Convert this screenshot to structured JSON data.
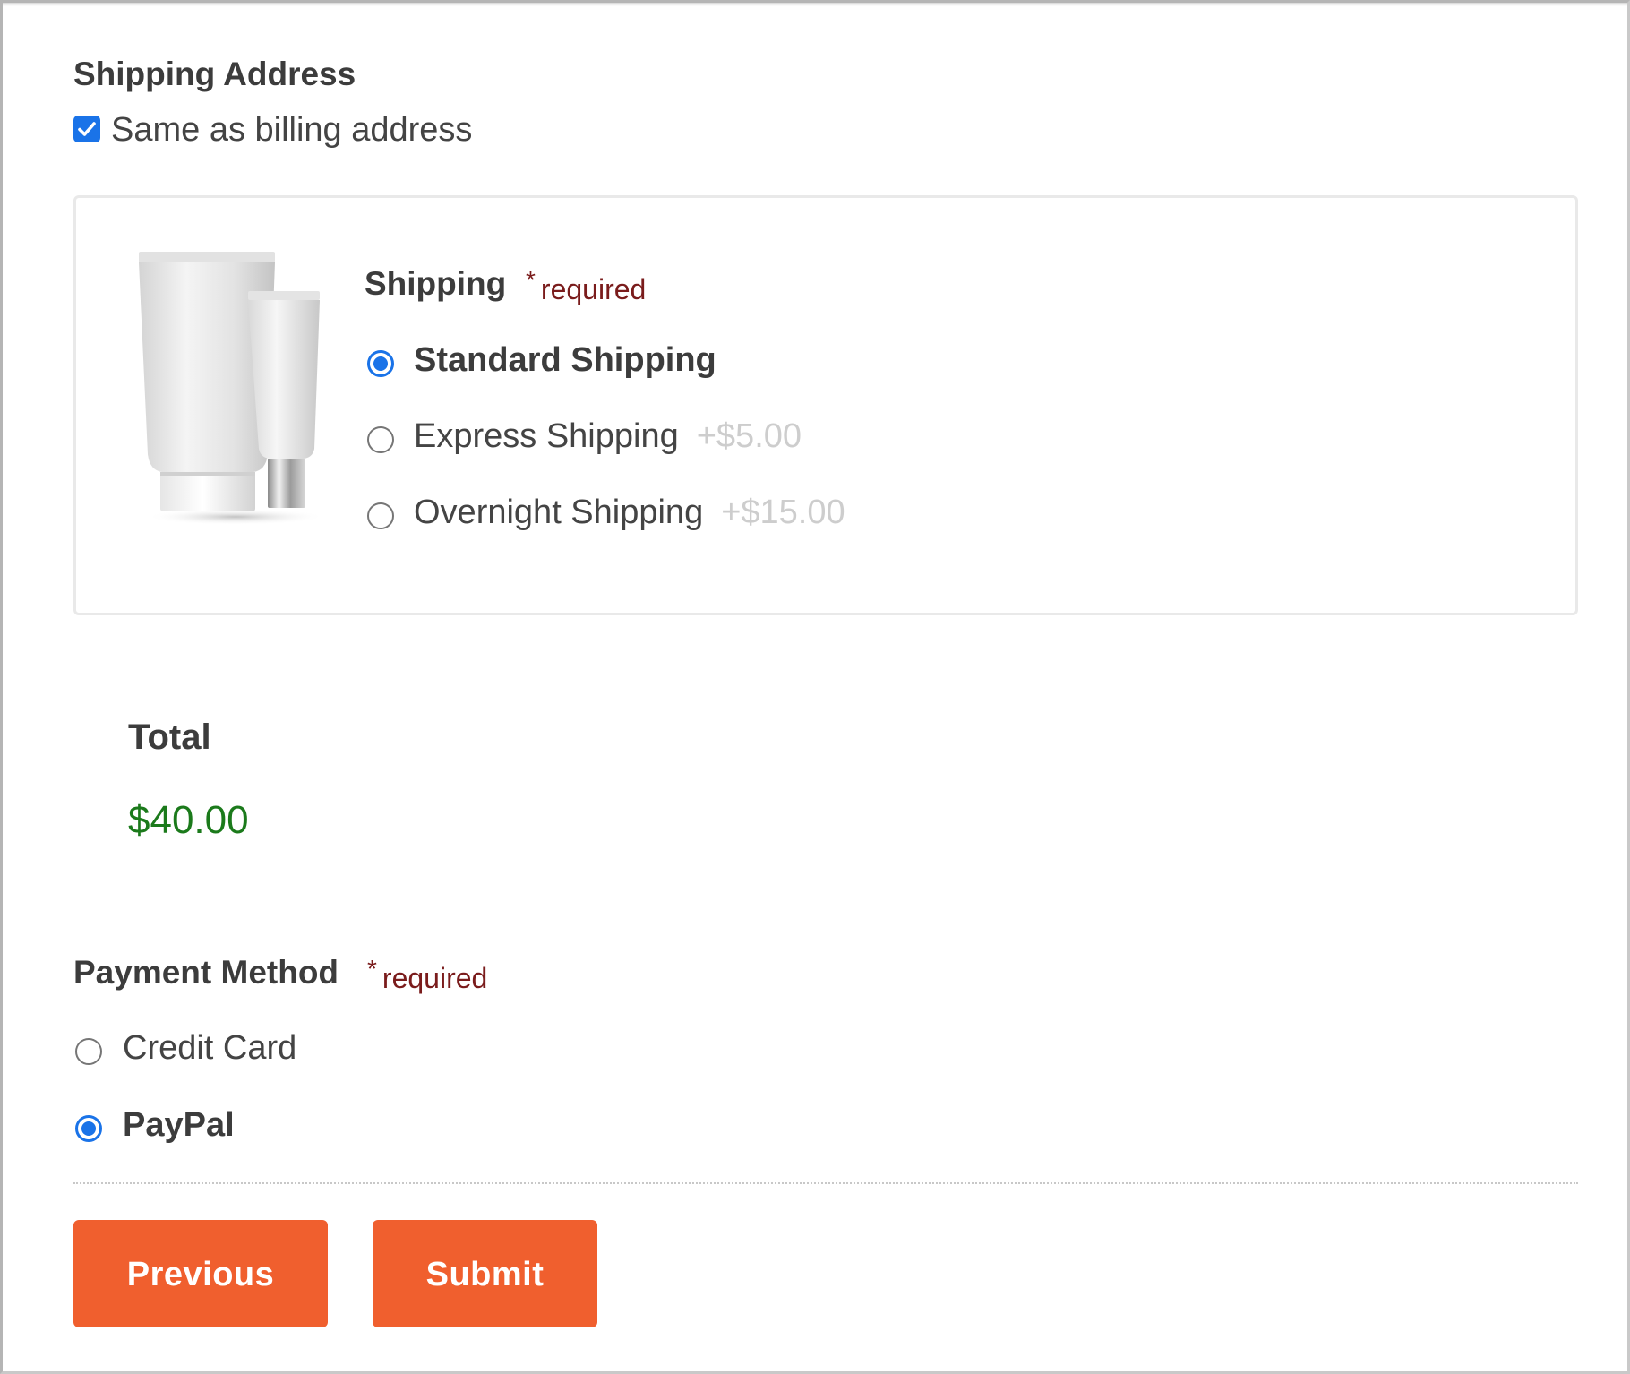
{
  "shipping_address": {
    "title": "Shipping Address",
    "same_as_billing_label": "Same as billing address",
    "same_as_billing_checked": true
  },
  "shipping": {
    "title": "Shipping",
    "required_star": "*",
    "required_text": "required",
    "product_image_icon": "cosmetic-tubes-image",
    "options": [
      {
        "label": "Standard Shipping",
        "price": "",
        "selected": true
      },
      {
        "label": "Express Shipping",
        "price": "+$5.00",
        "selected": false
      },
      {
        "label": "Overnight Shipping",
        "price": "+$15.00",
        "selected": false
      }
    ]
  },
  "total": {
    "label": "Total",
    "value": "$40.00"
  },
  "payment_method": {
    "title": "Payment Method",
    "required_star": "*",
    "required_text": "required",
    "options": [
      {
        "label": "Credit Card",
        "selected": false
      },
      {
        "label": "PayPal",
        "selected": true
      }
    ]
  },
  "buttons": {
    "previous_label": "Previous",
    "submit_label": "Submit"
  },
  "colors": {
    "accent_blue": "#1a73e8",
    "button_orange": "#f05f2e",
    "required_red": "#7a1c1c",
    "total_green": "#1b7a1b",
    "price_grey": "#cdcdcd"
  }
}
